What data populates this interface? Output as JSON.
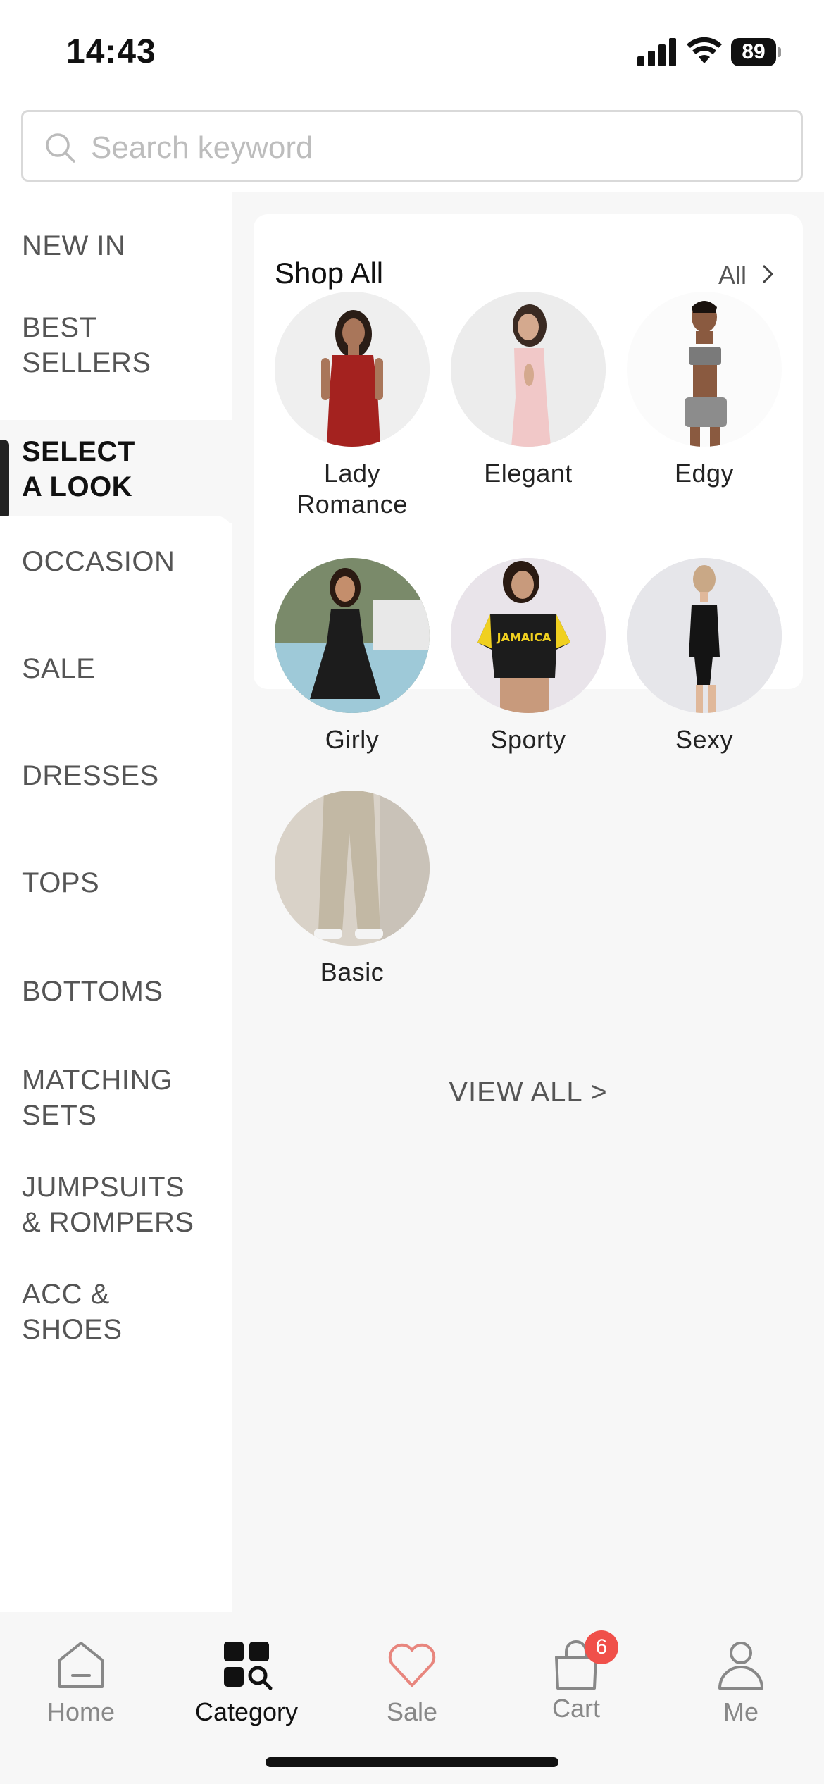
{
  "status_bar": {
    "time": "14:43",
    "battery": "89"
  },
  "search": {
    "placeholder": "Search keyword"
  },
  "sidebar": {
    "items": [
      {
        "label": "NEW IN",
        "active": false
      },
      {
        "label": "BEST\nSELLERS",
        "active": false
      },
      {
        "label": "SELECT\nA LOOK",
        "active": true
      },
      {
        "label": "OCCASION",
        "active": false
      },
      {
        "label": "SALE",
        "active": false
      },
      {
        "label": "DRESSES",
        "active": false
      },
      {
        "label": "TOPS",
        "active": false
      },
      {
        "label": "BOTTOMS",
        "active": false
      },
      {
        "label": "MATCHING\nSETS",
        "active": false
      },
      {
        "label": "JUMPSUITS\n& ROMPERS",
        "active": false
      },
      {
        "label": "ACC &\nSHOES",
        "active": false
      }
    ]
  },
  "shop_all": {
    "title": "Shop All",
    "all_link": "All",
    "looks": [
      {
        "label": "Lady\nRomance",
        "image": "woman in red strapless dress"
      },
      {
        "label": "Elegant",
        "image": "woman in pink cut-out dress"
      },
      {
        "label": "Edgy",
        "image": "woman in grey printed bandeau set"
      },
      {
        "label": "Girly",
        "image": "woman in black ruffle dress by pool"
      },
      {
        "label": "Sporty",
        "image": "woman in Jamaica crop top"
      },
      {
        "label": "Sexy",
        "image": "woman in black cut-out bodysuit"
      },
      {
        "label": "Basic",
        "image": "beige wide-leg trousers"
      }
    ]
  },
  "view_all": "VIEW ALL >",
  "tabbar": {
    "tabs": [
      {
        "label": "Home",
        "icon": "home-icon"
      },
      {
        "label": "Category",
        "icon": "category-icon",
        "active": true
      },
      {
        "label": "Sale",
        "icon": "heart-icon"
      },
      {
        "label": "Cart",
        "icon": "bag-icon",
        "badge": "6"
      },
      {
        "label": "Me",
        "icon": "person-icon"
      }
    ]
  },
  "colors": {
    "badge": "#f0504a",
    "sale_heart": "#e8867e",
    "active": "#111111",
    "inactive": "#888888"
  }
}
